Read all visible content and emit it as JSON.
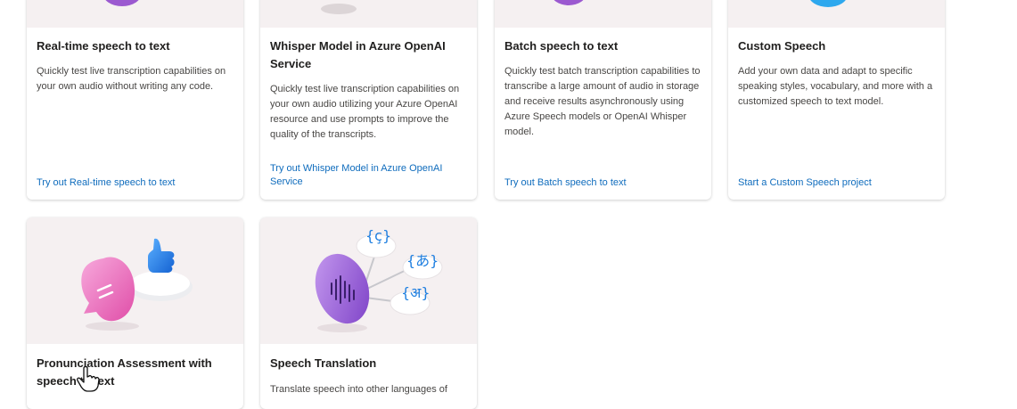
{
  "cards": [
    {
      "title": "Real-time speech to text",
      "description": "Quickly test live transcription capabilities on your own audio without writing any code.",
      "link": "Try out Real-time speech to text"
    },
    {
      "title": "Whisper Model in Azure OpenAI Service",
      "description": "Quickly test live transcription capabilities on your own audio utilizing your Azure OpenAI resource and use prompts to improve the quality of the transcripts.",
      "link": "Try out Whisper Model in Azure OpenAI Service"
    },
    {
      "title": "Batch speech to text",
      "description": "Quickly test batch transcription capabilities to transcribe a large amount of audio in storage and receive results asynchronously using Azure Speech models or OpenAI Whisper model.",
      "link": "Try out Batch speech to text"
    },
    {
      "title": "Custom Speech",
      "description": "Add your own data and adapt to specific speaking styles, vocabulary, and more with a customized speech to text model.",
      "link": "Start a Custom Speech project"
    },
    {
      "title": "Pronunciation Assessment with speech to text",
      "description": "",
      "link": ""
    },
    {
      "title": "Speech Translation",
      "description": "Translate speech into other languages of",
      "link": ""
    }
  ],
  "illustration": {
    "translation_glyphs": [
      "{ç}",
      "{あ}",
      "{अ}"
    ]
  },
  "colors": {
    "link": "#0f6cbd",
    "hero_background": "#f5f0f1",
    "accent_purple": "#9b59d0",
    "accent_pink": "#e86bb8",
    "accent_blue": "#1f7fe0"
  }
}
